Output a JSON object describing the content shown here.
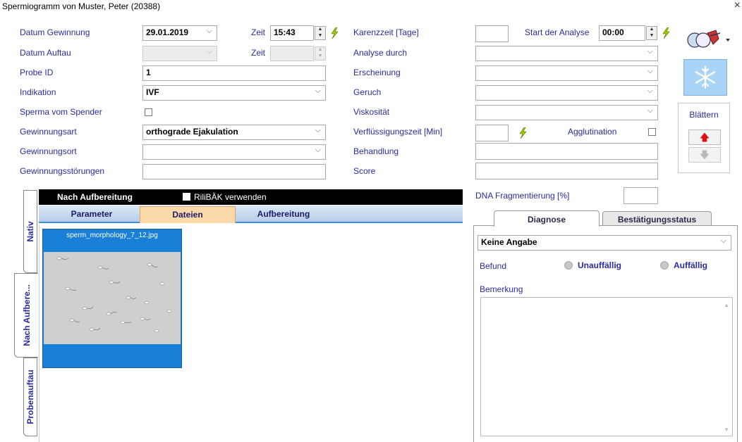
{
  "window": {
    "title": "Spermiogramm von Muster, Peter (20388)",
    "close": "×"
  },
  "left": {
    "datum_gewinnung_label": "Datum Gewinnung",
    "datum_gewinnung_value": "29.01.2019",
    "zeit_label": "Zeit",
    "zeit_value": "15:43",
    "datum_auftau_label": "Datum Auftau",
    "zeit2_label": "Zeit",
    "probe_id_label": "Probe ID",
    "probe_id_value": "1",
    "indikation_label": "Indikation",
    "indikation_value": "IVF",
    "sperma_label": "Sperma vom Spender",
    "gewinnungsart_label": "Gewinnungsart",
    "gewinnungsart_value": "orthograde Ejakulation",
    "gewinnungsort_label": "Gewinnungsort",
    "gewinnungsstoerungen_label": "Gewinnungsstörungen"
  },
  "middle": {
    "karenzzeit_label": "Karenzzeit [Tage]",
    "analyse_label": "Analyse durch",
    "erscheinung_label": "Erscheinung",
    "geruch_label": "Geruch",
    "viskositaet_label": "Viskosität",
    "verfluessigung_label": "Verflüssigungszeit [Min]",
    "behandlung_label": "Behandlung",
    "score_label": "Score"
  },
  "right": {
    "start_label": "Start der Analyse",
    "start_value": "00:00",
    "agglutination_label": "Agglutination",
    "blaettern_label": "Blättern",
    "dna_label": "DNA Fragmentierung [%]"
  },
  "panel": {
    "header_title": "Nach Aufbereitung",
    "rilibak_label": "RiliBÄK verwenden",
    "tabs": [
      "Parameter",
      "Dateien",
      "Aufbereitung"
    ],
    "file_name": "sperm_morphology_7_12.jpg"
  },
  "side_tabs": [
    "Nativ",
    "Nach Aufbere...",
    "Probenauftau"
  ],
  "diagnose": {
    "tabs": [
      "Diagnose",
      "Bestätigungsstatus"
    ],
    "select_value": "Keine Angabe",
    "befund_label": "Befund",
    "opt1": "Unauffällig",
    "opt2": "Auffällig",
    "bemerkung_label": "Bemerkung"
  },
  "colors": {
    "label": "#2b2b9e",
    "accent_blue": "#1a7fd6",
    "selected_tab": "#fcd9a8",
    "header_bar": "#000000"
  }
}
